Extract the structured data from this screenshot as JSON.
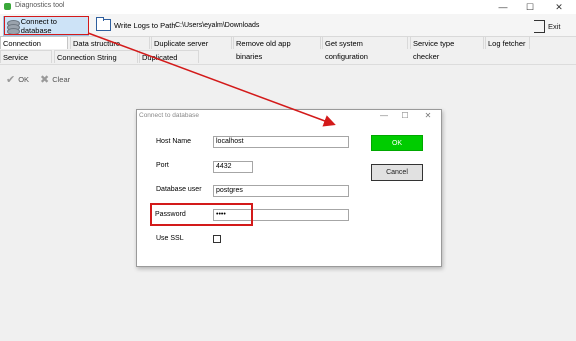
{
  "window": {
    "title": "Diagnostics tool",
    "controls": [
      "—",
      "☐",
      "✕"
    ]
  },
  "toolbar": {
    "connect_label": "Connect to database",
    "write_logs_label": "Write Logs to Path",
    "path_value": "C:\\Users\\eyalm\\Downloads",
    "exit_label": "Exit"
  },
  "tabs_row1": [
    "Connection Checker",
    "Data structure checker",
    "Duplicate server nodes",
    "Remove old app binaries",
    "Get system configuration",
    "Service type checker",
    "Log fetcher"
  ],
  "tabs_row2": [
    "Service cluster",
    "Connection String Editor",
    "Duplicated Users"
  ],
  "subbar": {
    "ok_label": "OK",
    "clear_label": "Clear"
  },
  "dialog": {
    "title": "Connect to database",
    "controls": [
      "—",
      "☐",
      "✕"
    ],
    "host_label": "Host Name",
    "host_value": "localhost",
    "port_label": "Port",
    "port_value": "4432",
    "user_label": "Database user",
    "user_value": "postgres",
    "password_label": "Password",
    "password_value": "••••",
    "ssl_label": "Use SSL",
    "ok_label": "OK",
    "cancel_label": "Cancel"
  },
  "colors": {
    "annotation": "#d31a1a",
    "ok_green": "#00cc00"
  },
  "icons": [
    "database-icon",
    "folder-icon",
    "exit-icon",
    "check-icon",
    "clear-x-icon"
  ]
}
